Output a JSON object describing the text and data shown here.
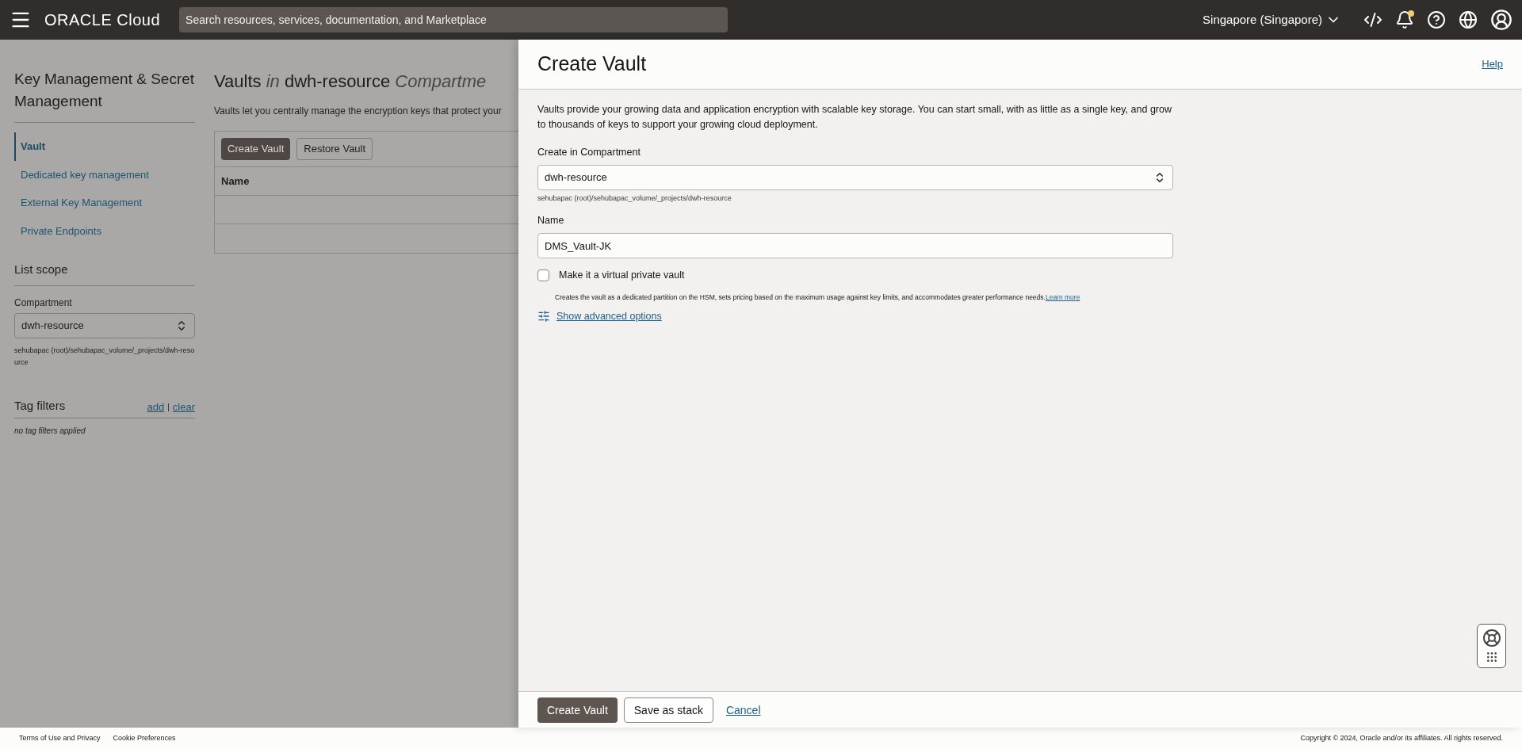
{
  "header": {
    "brand": "ORACLE Cloud",
    "search_placeholder": "Search resources, services, documentation, and Marketplace",
    "region": "Singapore (Singapore)",
    "notification_dot": true
  },
  "sidebar": {
    "title": "Key Management & Secret Management",
    "items": [
      {
        "label": "Vault",
        "selected": true
      },
      {
        "label": "Dedicated key management",
        "selected": false
      },
      {
        "label": "External Key Management",
        "selected": false
      },
      {
        "label": "Private Endpoints",
        "selected": false
      }
    ],
    "list_scope": {
      "title": "List scope",
      "compartment_label": "Compartment",
      "compartment_value": "dwh-resource",
      "compartment_path": "sehubapac (root)/sehubapac_volume/_projects/dwh-resource"
    },
    "tag_filters": {
      "title": "Tag filters",
      "add": "add",
      "separator": "|",
      "clear": "clear",
      "empty": "no tag filters applied"
    }
  },
  "main": {
    "title_parts": [
      "Vaults",
      "in",
      "dwh-resource",
      "Compartme"
    ],
    "description": "Vaults let you centrally manage the encryption keys that protect your",
    "buttons": [
      "Create Vault",
      "Restore Vault"
    ],
    "table": {
      "columns": [
        "Name"
      ]
    }
  },
  "drawer": {
    "title": "Create Vault",
    "help": "Help",
    "intro": "Vaults provide your growing data and application encryption with scalable key storage. You can start small, with as little as a single key, and grow to thousands of keys to support your growing cloud deployment.",
    "compartment": {
      "label": "Create in Compartment",
      "value": "dwh-resource",
      "path": "sehubapac (root)/sehubapac_volume/_projects/dwh-resource"
    },
    "name": {
      "label": "Name",
      "value": "DMS_Vault-JK"
    },
    "virtual_private": {
      "label": "Make it a virtual private vault",
      "checked": false,
      "help": "Creates the vault as a dedicated partition on the HSM, sets pricing based on the maximum usage against key limits, and accommodates greater performance needs.",
      "learn_more": "Learn more"
    },
    "advanced": "Show advanced options",
    "footer_buttons": [
      {
        "label": "Create Vault",
        "kind": "primary"
      },
      {
        "label": "Save as stack",
        "kind": "secondary"
      },
      {
        "label": "Cancel",
        "kind": "link"
      }
    ]
  },
  "footer": {
    "links": [
      "Terms of Use and Privacy",
      "Cookie Preferences"
    ],
    "copyright": "Copyright © 2024, Oracle and/or its affiliates. All rights reserved."
  }
}
